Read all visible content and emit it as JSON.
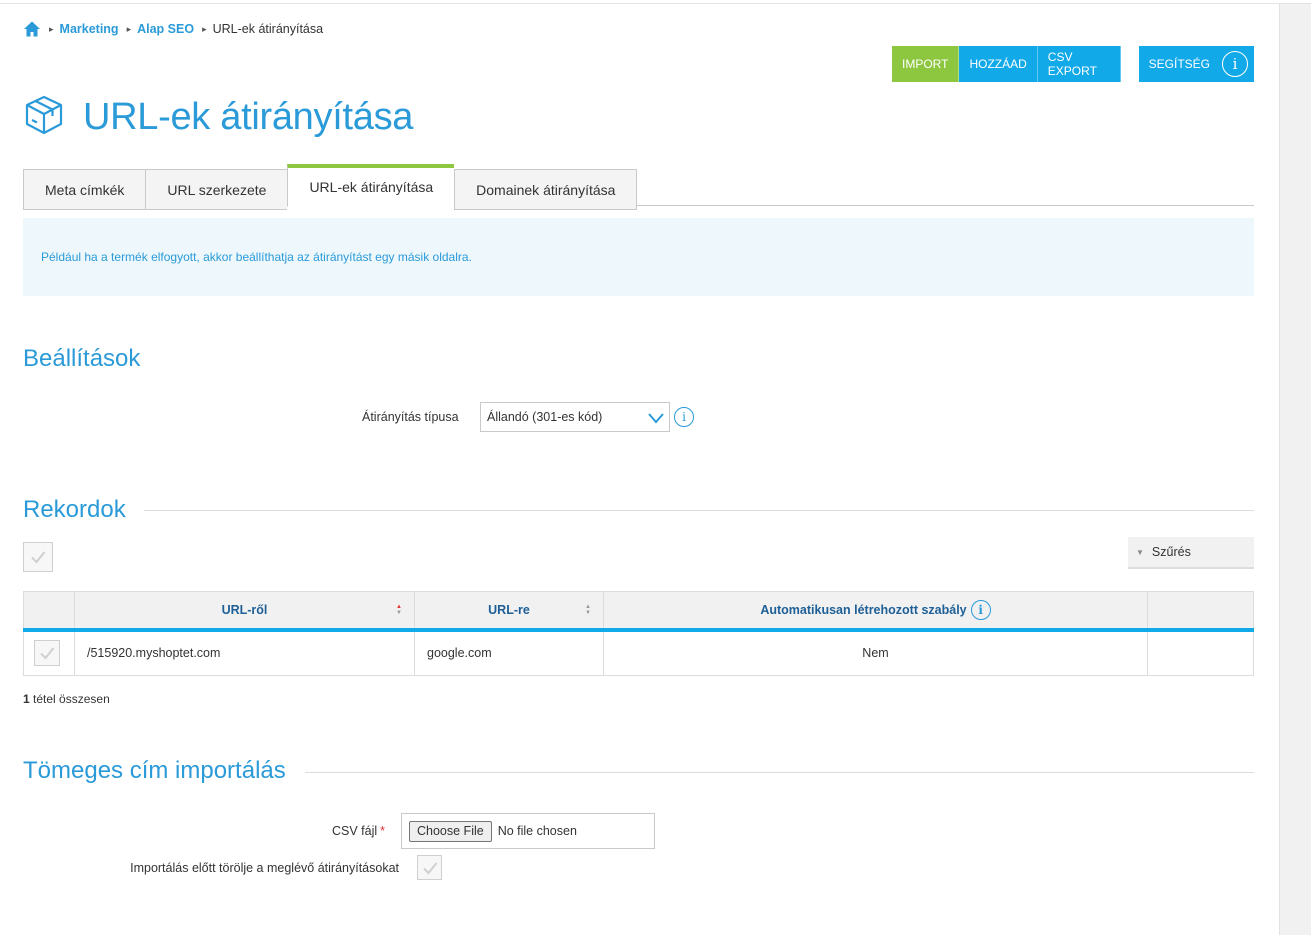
{
  "breadcrumb": {
    "home_icon": "home-icon",
    "items": [
      "Marketing",
      "Alap SEO"
    ],
    "current": "URL-ek átirányítása"
  },
  "actions": {
    "import": "IMPORT",
    "add": "HOZZÁAD",
    "csv_export": "CSV EXPORT",
    "help": "SEGÍTSÉG"
  },
  "page": {
    "title": "URL-ek átirányítása",
    "icon": "box-icon"
  },
  "tabs": [
    "Meta címkék",
    "URL szerkezete",
    "URL-ek átirányítása",
    "Domainek átirányítása"
  ],
  "info_text": "Például ha a termék elfogyott, akkor beállíthatja az átirányítást egy másik oldalra.",
  "settings": {
    "title": "Beállítások",
    "redirect_type_label": "Átirányítás típusa",
    "redirect_type_value": "Állandó (301-es kód)"
  },
  "records": {
    "title": "Rekordok",
    "filter_label": "Szűrés",
    "columns": [
      "URL-ről",
      "URL-re",
      "Automatikusan létrehozott szabály"
    ],
    "rows": [
      {
        "from": "/515920.myshoptet.com",
        "to": "google.com",
        "auto": "Nem"
      }
    ],
    "count": "1",
    "count_suffix": "tétel összesen"
  },
  "bulk_import": {
    "title": "Tömeges cím importálás",
    "csv_label": "CSV fájl",
    "choose_label": "Choose File",
    "no_file": "No file chosen",
    "delete_label": "Importálás előtt törölje a meglévő átirányításokat"
  },
  "colors": {
    "blue": "#2a9ad8",
    "button_blue": "#12a9e8",
    "green": "#8dc63f",
    "info_bg": "#eef8fc"
  }
}
